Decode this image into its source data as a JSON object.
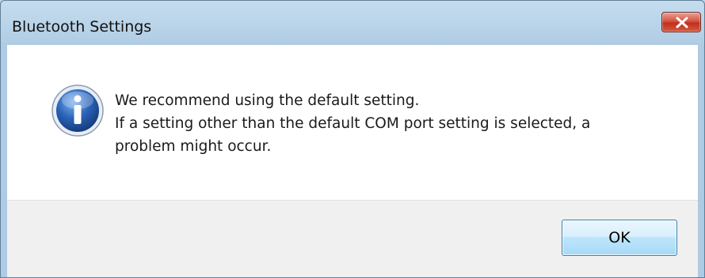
{
  "window": {
    "title": "Bluetooth Settings"
  },
  "message": {
    "lines": [
      "We recommend using the default setting.",
      "If a setting other than the default COM port setting is selected, a",
      "problem might occur."
    ]
  },
  "buttons": {
    "ok_label": "OK"
  },
  "icons": {
    "dialog_icon": "info-icon",
    "close": "close-icon"
  },
  "colors": {
    "close_button": "#c1301e",
    "ok_border": "#3c7fb1",
    "info_icon_blue": "#2a63b8"
  }
}
